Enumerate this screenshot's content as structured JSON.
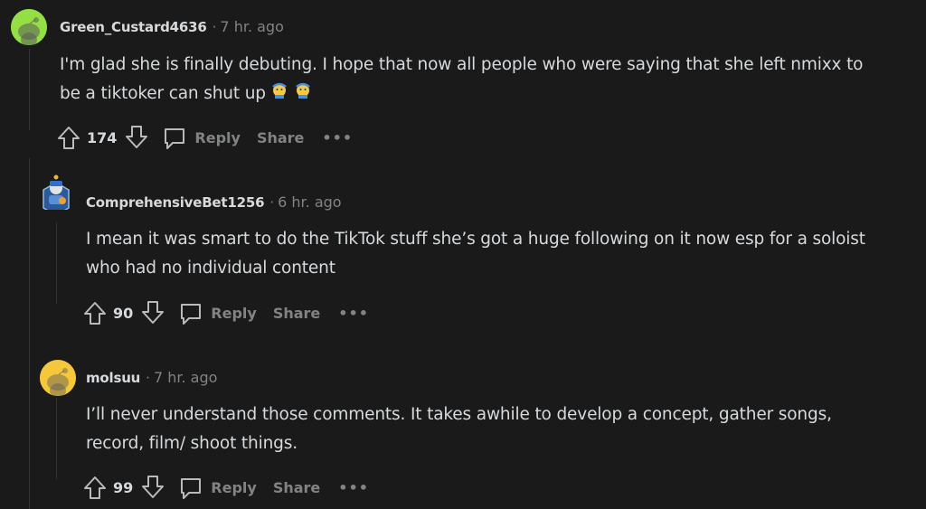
{
  "comments": [
    {
      "username": "Green_Custard4636",
      "time": "7 hr. ago",
      "text": "I'm glad she is finally debuting. I hope that now all people who were saying that she left nmixx to\nbe a tiktoker can shut up",
      "votes": "174",
      "reply_label": "Reply",
      "share_label": "Share",
      "more_label": "•••",
      "avatar_color": "#94e044",
      "emoji": "face-with-tears-emoji"
    },
    {
      "username": "ComprehensiveBet1256",
      "time": "6 hr. ago",
      "text": "I mean it was smart to do the TikTok stuff she’s got a huge following on it now esp for a soloist\nwho had no individual content",
      "votes": "90",
      "reply_label": "Reply",
      "share_label": "Share",
      "more_label": "•••",
      "avatar_color": "#3a6fb0"
    },
    {
      "username": "molsuu",
      "time": "7 hr. ago",
      "text": "I’ll never understand those comments. It takes awhile to develop a concept, gather songs,\nrecord, film/ shoot things.",
      "votes": "99",
      "reply_label": "Reply",
      "share_label": "Share",
      "more_label": "•••",
      "avatar_color": "#f5c73a"
    }
  ],
  "separator": "·",
  "colors": {
    "background": "#1a1a1b",
    "text": "#d7dadc",
    "muted": "#818384",
    "thread_line": "#343536"
  }
}
